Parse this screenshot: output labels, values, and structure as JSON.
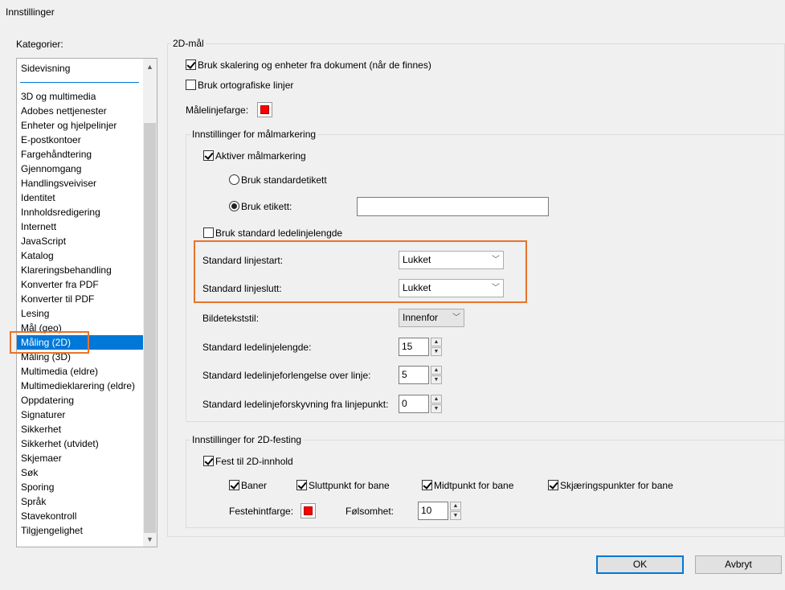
{
  "window": {
    "title": "Innstillinger"
  },
  "categories": {
    "label": "Kategorier:",
    "top_item": "Sidevisning",
    "items": [
      "3D og multimedia",
      "Adobes nettjenester",
      "Enheter og hjelpelinjer",
      "E-postkontoer",
      "Fargehåndtering",
      "Gjennomgang",
      "Handlingsveiviser",
      "Identitet",
      "Innholdsredigering",
      "Internett",
      "JavaScript",
      "Katalog",
      "Klareringsbehandling",
      "Konverter fra PDF",
      "Konverter til PDF",
      "Lesing",
      "Mål (geo)",
      "Måling (2D)",
      "Måling (3D)",
      "Multimedia (eldre)",
      "Multimedieklarering (eldre)",
      "Oppdatering",
      "Signaturer",
      "Sikkerhet",
      "Sikkerhet (utvidet)",
      "Skjemaer",
      "Søk",
      "Sporing",
      "Språk",
      "Stavekontroll",
      "Tilgjengelighet"
    ],
    "selected": "Måling (2D)"
  },
  "measure2d": {
    "group_title": "2D-mål",
    "use_scale_label": "Bruk skalering og enheter fra dokument (når de finnes)",
    "use_scale_checked": true,
    "ortho_label": "Bruk ortografiske linjer",
    "ortho_checked": false,
    "line_color_label": "Målelinjefarge:",
    "line_color": "#ff0000"
  },
  "markup": {
    "group_title": "Innstillinger for målmarkering",
    "enable_label": "Aktiver målmarkering",
    "enable_checked": true,
    "radio_default_label": "Bruk standardetikett",
    "radio_custom_label": "Bruk etikett:",
    "custom_label_value": "",
    "leader_default_label": "Bruk standard ledelinjelengde",
    "leader_default_checked": false,
    "line_start_label": "Standard linjestart:",
    "line_start_value": "Lukket",
    "line_end_label": "Standard linjeslutt:",
    "line_end_value": "Lukket",
    "caption_label": "Bildetekststil:",
    "caption_value": "Innenfor",
    "leader_length_label": "Standard ledelinjelengde:",
    "leader_length_value": "15",
    "leader_ext_label": "Standard ledelinjeforlengelse over linje:",
    "leader_ext_value": "5",
    "leader_offset_label": "Standard ledelinjeforskyvning fra linjepunkt:",
    "leader_offset_value": "0"
  },
  "snap": {
    "group_title": "Innstillinger for 2D-festing",
    "snap_label": "Fest til 2D-innhold",
    "snap_checked": true,
    "paths_label": "Baner",
    "endpoints_label": "Sluttpunkt for bane",
    "midpoints_label": "Midtpunkt for bane",
    "intersections_label": "Skjæringspunkter for bane",
    "hint_color_label": "Festehintfarge:",
    "hint_color": "#ff0000",
    "sensitivity_label": "Følsomhet:",
    "sensitivity_value": "10"
  },
  "footer": {
    "ok_label": "OK",
    "cancel_label": "Avbryt"
  },
  "colors": {
    "highlight": "#e8732a",
    "selection": "#0078d7"
  }
}
